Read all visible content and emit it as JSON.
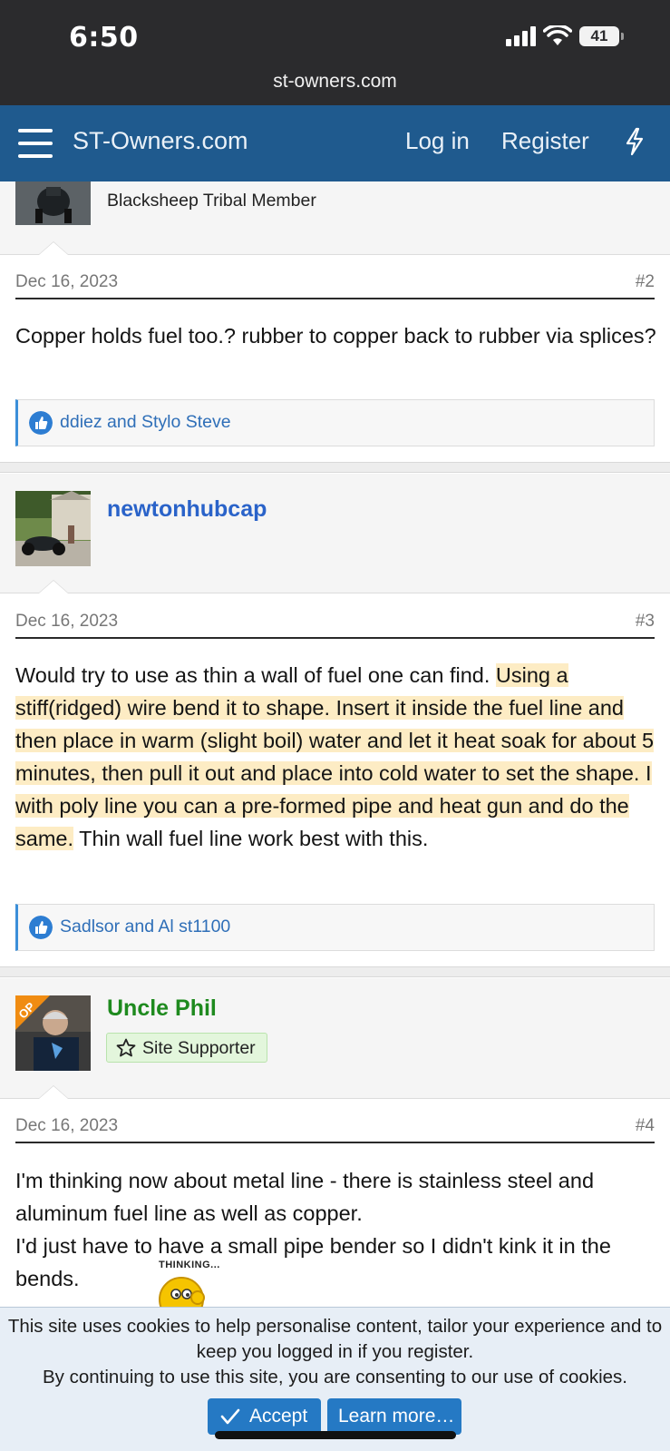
{
  "status_bar": {
    "time": "6:50",
    "battery": "41",
    "url": "st-owners.com"
  },
  "navbar": {
    "brand": "ST-Owners.com",
    "login": "Log in",
    "register": "Register"
  },
  "posts": [
    {
      "user_title": "Blacksheep Tribal Member"
    },
    {
      "date": "Dec 16, 2023",
      "number": "#2",
      "text": "Copper holds fuel too.? rubber to copper back to rubber via splices?",
      "reactions": "ddiez and Stylo Steve"
    },
    {
      "username": "newtonhubcap",
      "date": "Dec 16, 2023",
      "number": "#3",
      "text_before": "Would try to use as thin a wall of fuel one can find. ",
      "text_highlight": "Using a stiff(ridged) wire bend it to shape. Insert it inside the fuel line and then place in warm (slight boil) water and let it heat soak for about 5 minutes, then pull it out and place into cold water to set the shape. I with poly line you can a pre-formed pipe and heat gun and do the same.",
      "text_after": " Thin wall fuel line work best with this.",
      "reactions": "Sadlsor and Al st1100"
    },
    {
      "username": "Uncle Phil",
      "op_label": "OP",
      "badge": "Site Supporter",
      "date": "Dec 16, 2023",
      "number": "#4",
      "line1": "I'm thinking now about metal line - there is stainless steel and aluminum fuel line as well as copper.",
      "line2": "I'd just have to have a small pipe bender so I didn't kink it in the bends.",
      "smiley_label": "THINKING..."
    }
  ],
  "cookie": {
    "line1": "This site uses cookies to help personalise content, tailor your experience and to keep you logged in if you register.",
    "line2": "By continuing to use this site, you are consenting to our use of cookies.",
    "accept": "Accept",
    "learn_more": "Learn more…"
  },
  "colors": {
    "navbar": "#1f5a8e",
    "link": "#2f6fb8",
    "username_blue": "#2a63c9",
    "username_green": "#1e8a1e",
    "highlight": "#fdecc4"
  }
}
